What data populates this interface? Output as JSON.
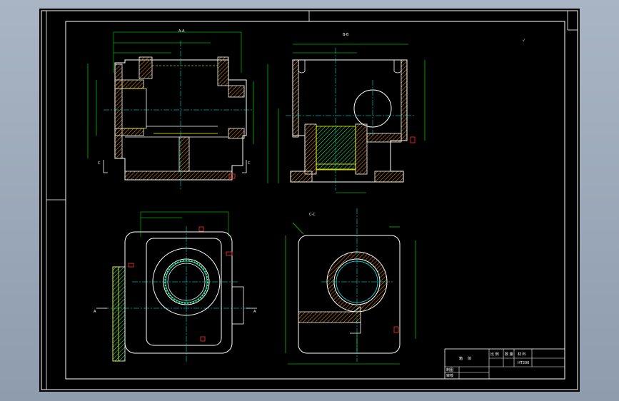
{
  "drawing": {
    "views": {
      "top_left": {
        "label": "A-A"
      },
      "top_right": {
        "label": "B-B"
      },
      "bottom_right": {
        "label": "C-C"
      }
    },
    "section_marks": {
      "c_left": "C",
      "c_right": "C",
      "a_left": "A",
      "a_right": "A"
    },
    "roughness_symbol": "√"
  },
  "title_block": {
    "name_cells": [
      "箱",
      "体"
    ],
    "scale_header": [
      "比 例",
      "数 量",
      "材 料"
    ],
    "material": "HT200",
    "role_rows": [
      "制图",
      "审核"
    ]
  },
  "colors": {
    "outline": "#ffffff",
    "geometry": "#ffff00",
    "hatch": "#ff9900",
    "dimension": "#00ff00",
    "centerline": "#00ffff",
    "marker": "#ff3030"
  }
}
